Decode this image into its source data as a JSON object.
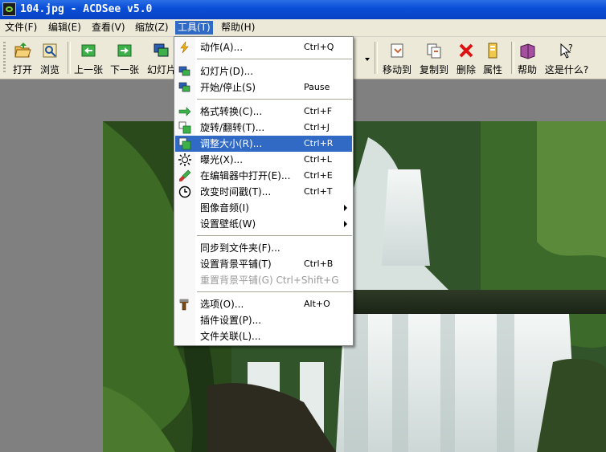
{
  "window": {
    "title": "104.jpg - ACDSee v5.0"
  },
  "menubar": [
    {
      "label": "文件(F)"
    },
    {
      "label": "编辑(E)"
    },
    {
      "label": "查看(V)"
    },
    {
      "label": "缩放(Z)"
    },
    {
      "label": "工具(T)"
    },
    {
      "label": "帮助(H)"
    }
  ],
  "toolbar": [
    {
      "label": "打开",
      "icon": "open-folder-icon"
    },
    {
      "label": "浏览",
      "icon": "browse-icon"
    },
    {
      "label": "上一张",
      "icon": "previous-arrow-icon"
    },
    {
      "label": "下一张",
      "icon": "next-arrow-icon"
    },
    {
      "label": "幻灯片",
      "icon": "slideshow-icon"
    },
    {
      "label": "移动到",
      "icon": "move-to-icon"
    },
    {
      "label": "复制到",
      "icon": "copy-to-icon"
    },
    {
      "label": "删除",
      "icon": "delete-x-icon"
    },
    {
      "label": "属性",
      "icon": "properties-icon"
    },
    {
      "label": "帮助",
      "icon": "help-book-icon"
    },
    {
      "label": "这是什么?",
      "icon": "whats-this-icon"
    }
  ],
  "tools_menu": {
    "items": [
      {
        "label": "动作(A)...",
        "shortcut": "Ctrl+Q",
        "icon": "lightning-icon"
      },
      {
        "label": "幻灯片(D)...",
        "shortcut": "",
        "icon": "slideshow-icon"
      },
      {
        "label": "开始/停止(S)",
        "shortcut": "Pause",
        "icon": "start-stop-icon"
      },
      {
        "label": "格式转换(C)...",
        "shortcut": "Ctrl+F",
        "icon": "convert-format-icon"
      },
      {
        "label": "旋转/翻转(T)...",
        "shortcut": "Ctrl+J",
        "icon": "rotate-flip-icon"
      },
      {
        "label": "调整大小(R)...",
        "shortcut": "Ctrl+R",
        "icon": "resize-icon"
      },
      {
        "label": "曝光(X)...",
        "shortcut": "Ctrl+L",
        "icon": "exposure-sun-icon"
      },
      {
        "label": "在编辑器中打开(E)...",
        "shortcut": "Ctrl+E",
        "icon": "editor-brush-icon"
      },
      {
        "label": "改变时间戳(T)...",
        "shortcut": "Ctrl+T",
        "icon": "clock-icon"
      },
      {
        "label": "图像音频(I)",
        "shortcut": "",
        "icon": ""
      },
      {
        "label": "设置壁纸(W)",
        "shortcut": "",
        "icon": ""
      },
      {
        "label": "同步到文件夹(F)...",
        "shortcut": "",
        "icon": ""
      },
      {
        "label": "设置背景平铺(T)",
        "shortcut": "Ctrl+B",
        "icon": ""
      },
      {
        "label": "重置背景平铺(G) Ctrl+Shift+G",
        "shortcut": "",
        "icon": ""
      },
      {
        "label": "选项(O)...",
        "shortcut": "Alt+O",
        "icon": "options-hammer-icon"
      },
      {
        "label": "插件设置(P)...",
        "shortcut": "",
        "icon": ""
      },
      {
        "label": "文件关联(L)...",
        "shortcut": "",
        "icon": ""
      }
    ]
  },
  "colors": {
    "titlebar": "#0a4fd8",
    "menu_highlight": "#316ac5",
    "menubar_bg": "#ece9d8",
    "viewer_bg": "#808080"
  }
}
